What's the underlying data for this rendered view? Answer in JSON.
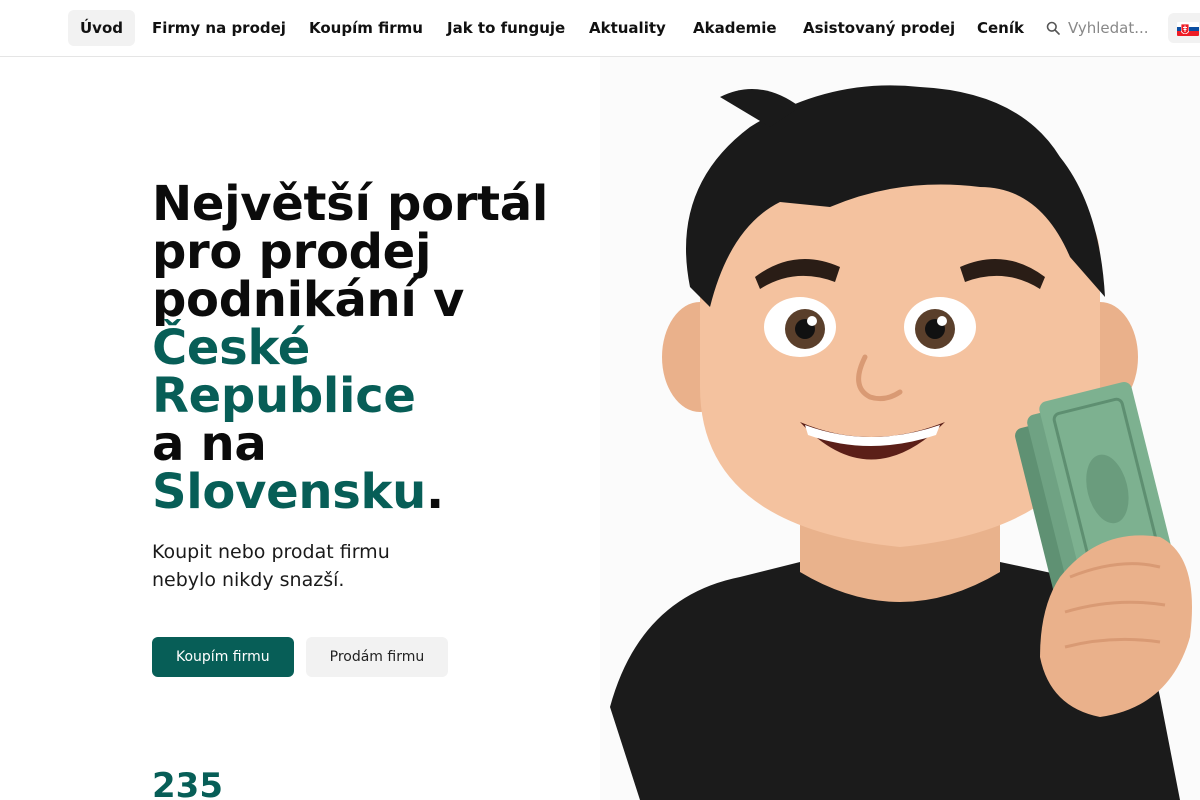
{
  "nav": {
    "items": [
      {
        "label": "Úvod",
        "active": true
      },
      {
        "label": "Firmy na prodej",
        "active": false
      },
      {
        "label": "Koupím firmu",
        "active": false
      },
      {
        "label": "Jak to funguje",
        "active": false
      },
      {
        "label": "Aktuality",
        "active": false
      },
      {
        "label": "Akademie",
        "active": false
      },
      {
        "label": "Asistovaný prodej",
        "active": false
      },
      {
        "label": "Ceník",
        "active": false
      }
    ],
    "search_placeholder": "Vyhledat...",
    "language_flag": "slovak-flag-icon"
  },
  "hero": {
    "line1": "Největší portál",
    "line2": "pro prodej",
    "line3": "podnikání v",
    "accent1": "České",
    "accent2": "Republice",
    "line4": "a na",
    "accent3": "Slovensku",
    "punct": ".",
    "subtitle": "Koupit nebo prodat firmu nebylo nikdy snazší.",
    "btn_primary": "Koupím firmu",
    "btn_secondary": "Prodám firmu",
    "stat_partial": "235"
  },
  "colors": {
    "accent": "#075e57",
    "button_secondary_bg": "#f2f2f2",
    "nav_active_bg": "#f2f2f2"
  }
}
